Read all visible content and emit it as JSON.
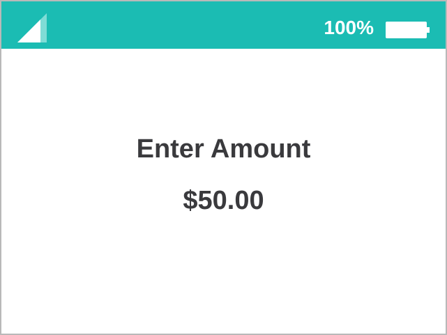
{
  "status_bar": {
    "signal_icon": "signal-icon",
    "battery_percent": "100%",
    "battery_icon": "battery-full-icon",
    "background_color": "#1bbcb3"
  },
  "main": {
    "title": "Enter Amount",
    "amount": "$50.00"
  }
}
